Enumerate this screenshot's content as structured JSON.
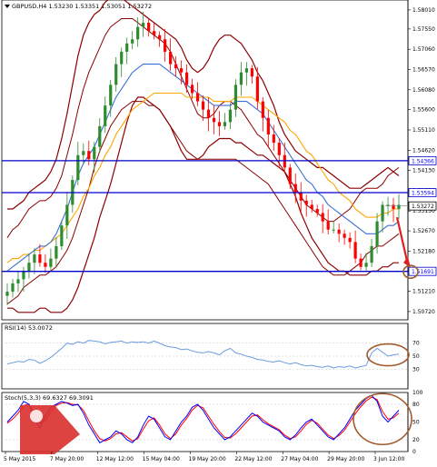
{
  "colors": {
    "bull_candle": "#2e8b2e",
    "bear_candle": "#ff0000",
    "envelope": "#8b0000",
    "ma_fast": "#3c6fd6",
    "ma_slow": "#ffa500",
    "levels": "#0000cd",
    "rsi_line": "#6a9be0",
    "stoch_main": "#0000ff",
    "stoch_signal": "#ff0000",
    "annotation": "#a05a2c",
    "arrow": "#e02020"
  },
  "icons": [
    "dropdown-triangle-icon",
    "instaforex-logo-icon",
    "down-arrow-annotation",
    "ellipse-annotation"
  ],
  "chart_data": [
    {
      "type": "line",
      "header": "GBPUSD,H4  1.53230 1.53351 1.53051 1.53272",
      "y_ticks": [
        "1.58010",
        "1.57550",
        "1.57060",
        "1.56570",
        "1.56080",
        "1.55600",
        "1.55110",
        "1.54620",
        "1.54130",
        "1.53650",
        "1.53150",
        "1.52670",
        "1.52180",
        "1.51690",
        "1.51210",
        "1.50720"
      ],
      "ylim": [
        1.5052,
        1.5825
      ],
      "x_ticks": [
        "5 May 2015",
        "7 May 20:00",
        "12 May 12:00",
        "15 May 04:00",
        "19 May 20:00",
        "22 May 12:00",
        "27 May 04:00",
        "29 May 20:00",
        "3 Jun 12:00"
      ],
      "levels": [
        {
          "label": "1.54366",
          "value": 1.54366
        },
        {
          "label": "1.53594",
          "value": 1.53594
        },
        {
          "label": "1.51691",
          "value": 1.51691
        }
      ],
      "current_price_label": "1.53272",
      "current_price": 1.53272,
      "series": [
        {
          "values": [
            1.512,
            1.514,
            1.515,
            1.517,
            1.519,
            1.521,
            1.519,
            1.518,
            1.52,
            1.523,
            1.528,
            1.533,
            1.539,
            1.545,
            1.546,
            1.544,
            1.547,
            1.552,
            1.557,
            1.562,
            1.567,
            1.57,
            1.572,
            1.573,
            1.576,
            1.577,
            1.575,
            1.574,
            1.573,
            1.57,
            1.567,
            1.566,
            1.565,
            1.562,
            1.56,
            1.558,
            1.556,
            1.554,
            1.553,
            1.552,
            1.553,
            1.556,
            1.562,
            1.565,
            1.566,
            1.564,
            1.558,
            1.554,
            1.55,
            1.548,
            1.545,
            1.542,
            1.538,
            1.536,
            1.534,
            1.533,
            1.532,
            1.531,
            1.529,
            1.527,
            1.527,
            1.526,
            1.525,
            1.524,
            1.52,
            1.518,
            1.519,
            1.523,
            1.529,
            1.533,
            1.533,
            1.532,
            1.533
          ]
        },
        {
          "values": [
            1.517,
            1.518,
            1.519,
            1.52,
            1.521,
            1.522,
            1.523,
            1.523,
            1.524,
            1.526,
            1.529,
            1.532,
            1.536,
            1.54,
            1.543,
            1.545,
            1.547,
            1.55,
            1.553,
            1.556,
            1.559,
            1.561,
            1.563,
            1.565,
            1.566,
            1.567,
            1.567,
            1.567,
            1.567,
            1.566,
            1.565,
            1.564,
            1.563,
            1.562,
            1.561,
            1.56,
            1.559,
            1.558,
            1.557,
            1.557,
            1.557,
            1.557,
            1.558,
            1.558,
            1.558,
            1.557,
            1.556,
            1.555,
            1.553,
            1.551,
            1.549,
            1.547,
            1.545,
            1.543,
            1.541,
            1.539,
            1.538,
            1.536,
            1.535,
            1.533,
            1.532,
            1.531,
            1.53,
            1.529,
            1.528,
            1.527,
            1.526,
            1.526,
            1.526,
            1.527,
            1.528,
            1.528,
            1.529
          ]
        },
        {
          "values": [
            1.519,
            1.52,
            1.52,
            1.521,
            1.521,
            1.522,
            1.522,
            1.523,
            1.524,
            1.525,
            1.526,
            1.528,
            1.53,
            1.532,
            1.535,
            1.537,
            1.54,
            1.542,
            1.545,
            1.547,
            1.55,
            1.552,
            1.554,
            1.556,
            1.557,
            1.558,
            1.559,
            1.56,
            1.56,
            1.56,
            1.56,
            1.56,
            1.56,
            1.559,
            1.559,
            1.559,
            1.559,
            1.559,
            1.558,
            1.558,
            1.558,
            1.558,
            1.559,
            1.559,
            1.559,
            1.559,
            1.558,
            1.557,
            1.556,
            1.555,
            1.554,
            1.553,
            1.551,
            1.55,
            1.548,
            1.546,
            1.545,
            1.543,
            1.541,
            1.539,
            1.538,
            1.536,
            1.535,
            1.534,
            1.532,
            1.531,
            1.53,
            1.53,
            1.53,
            1.531,
            1.531,
            1.532,
            1.532
          ]
        },
        {
          "values": [
            1.532,
            1.532,
            1.533,
            1.534,
            1.536,
            1.537,
            1.538,
            1.539,
            1.541,
            1.544,
            1.549,
            1.555,
            1.562,
            1.569,
            1.574,
            1.577,
            1.579,
            1.58,
            1.582,
            1.583,
            1.583,
            1.583,
            1.582,
            1.581,
            1.58,
            1.579,
            1.578,
            1.577,
            1.576,
            1.575,
            1.574,
            1.573,
            1.571,
            1.568,
            1.566,
            1.565,
            1.566,
            1.568,
            1.571,
            1.573,
            1.574,
            1.574,
            1.573,
            1.572,
            1.57,
            1.568,
            1.565,
            1.563,
            1.56,
            1.557,
            1.553,
            1.55,
            1.548,
            1.546,
            1.545,
            1.544,
            1.543,
            1.542,
            1.542,
            1.541,
            1.54,
            1.539,
            1.538,
            1.537,
            1.537,
            1.537,
            1.538,
            1.539,
            1.54,
            1.541,
            1.542,
            1.541,
            1.54
          ]
        },
        {
          "values": [
            1.508,
            1.508,
            1.507,
            1.507,
            1.507,
            1.507,
            1.508,
            1.508,
            1.507,
            1.507,
            1.507,
            1.508,
            1.51,
            1.513,
            1.517,
            1.521,
            1.525,
            1.53,
            1.534,
            1.538,
            1.543,
            1.548,
            1.553,
            1.557,
            1.559,
            1.559,
            1.558,
            1.557,
            1.556,
            1.554,
            1.552,
            1.549,
            1.546,
            1.544,
            1.544,
            1.544,
            1.545,
            1.547,
            1.548,
            1.549,
            1.549,
            1.549,
            1.548,
            1.548,
            1.547,
            1.546,
            1.545,
            1.545,
            1.544,
            1.543,
            1.542,
            1.541,
            1.538,
            1.535,
            1.531,
            1.528,
            1.525,
            1.523,
            1.521,
            1.519,
            1.518,
            1.517,
            1.517,
            1.516,
            1.516,
            1.516,
            1.516,
            1.517,
            1.517,
            1.518,
            1.518,
            1.519,
            1.519
          ]
        },
        {
          "values": [
            1.525,
            1.527,
            1.528,
            1.53,
            1.532,
            1.533,
            1.534,
            1.534,
            1.535,
            1.537,
            1.54,
            1.545,
            1.55,
            1.556,
            1.561,
            1.565,
            1.568,
            1.571,
            1.574,
            1.576,
            1.577,
            1.578,
            1.578,
            1.578,
            1.577,
            1.576,
            1.575,
            1.574,
            1.573,
            1.572,
            1.57,
            1.567,
            1.564,
            1.561,
            1.558,
            1.555,
            1.554,
            1.554,
            1.555,
            1.557,
            1.558,
            1.558,
            1.557,
            1.556,
            1.554,
            1.552,
            1.55,
            1.549,
            1.547,
            1.545,
            1.543,
            1.541,
            1.539,
            1.537,
            1.535,
            1.533,
            1.532,
            1.531,
            1.53,
            1.529,
            1.529,
            1.53,
            1.531,
            1.532,
            1.534,
            1.536,
            1.537,
            1.537,
            1.537,
            1.538,
            1.54,
            1.541,
            1.542
          ]
        },
        {
          "values": [
            1.509,
            1.51,
            1.511,
            1.513,
            1.514,
            1.515,
            1.516,
            1.516,
            1.517,
            1.518,
            1.52,
            1.522,
            1.525,
            1.529,
            1.533,
            1.537,
            1.542,
            1.546,
            1.549,
            1.552,
            1.554,
            1.556,
            1.557,
            1.558,
            1.558,
            1.558,
            1.557,
            1.557,
            1.556,
            1.554,
            1.552,
            1.55,
            1.548,
            1.546,
            1.545,
            1.544,
            1.544,
            1.544,
            1.544,
            1.544,
            1.544,
            1.544,
            1.544,
            1.543,
            1.542,
            1.541,
            1.54,
            1.539,
            1.538,
            1.536,
            1.534,
            1.532,
            1.53,
            1.528,
            1.526,
            1.524,
            1.522,
            1.52,
            1.518,
            1.517,
            1.516,
            1.516,
            1.516,
            1.517,
            1.518,
            1.519,
            1.521,
            1.522,
            1.523,
            1.523,
            1.524,
            1.525,
            1.526
          ]
        }
      ]
    },
    {
      "type": "line",
      "header": "RSI(14) 53.0072",
      "y_ticks": [
        "70",
        "50",
        "30"
      ],
      "ylim": [
        0,
        100
      ],
      "series": [
        {
          "values": [
            38,
            40,
            42,
            41,
            45,
            44,
            39,
            43,
            48,
            55,
            62,
            70,
            68,
            72,
            70,
            74,
            73,
            72,
            69,
            71,
            72,
            73,
            70,
            72,
            71,
            72,
            70,
            73,
            70,
            66,
            64,
            63,
            60,
            61,
            58,
            56,
            55,
            57,
            55,
            52,
            58,
            62,
            55,
            53,
            50,
            48,
            45,
            44,
            42,
            41,
            43,
            40,
            38,
            40,
            37,
            35,
            36,
            34,
            33,
            35,
            32,
            34,
            33,
            35,
            32,
            34,
            36,
            55,
            62,
            56,
            50,
            52,
            53
          ]
        }
      ]
    },
    {
      "type": "line",
      "header": "Stoch(5,3,3) 69.6327 69.3091",
      "y_ticks": [
        "100",
        "80",
        "50",
        "20",
        "0"
      ],
      "ylim": [
        0,
        100
      ],
      "series": [
        {
          "values": [
            50,
            60,
            70,
            85,
            80,
            55,
            40,
            60,
            75,
            80,
            85,
            82,
            78,
            80,
            65,
            45,
            30,
            15,
            20,
            25,
            35,
            30,
            20,
            15,
            25,
            45,
            60,
            55,
            40,
            25,
            20,
            35,
            50,
            60,
            75,
            80,
            70,
            55,
            40,
            30,
            20,
            25,
            35,
            45,
            55,
            65,
            60,
            50,
            45,
            40,
            35,
            25,
            20,
            28,
            40,
            50,
            55,
            45,
            35,
            25,
            20,
            30,
            40,
            55,
            70,
            80,
            90,
            95,
            85,
            60,
            50,
            60,
            70
          ]
        },
        {
          "values": [
            48,
            55,
            65,
            78,
            80,
            65,
            48,
            52,
            68,
            78,
            82,
            83,
            80,
            79,
            70,
            52,
            35,
            22,
            18,
            22,
            30,
            32,
            25,
            18,
            22,
            38,
            52,
            57,
            45,
            30,
            22,
            30,
            45,
            56,
            70,
            78,
            74,
            60,
            46,
            34,
            24,
            23,
            30,
            40,
            50,
            60,
            62,
            54,
            47,
            42,
            37,
            28,
            22,
            25,
            35,
            46,
            53,
            48,
            38,
            28,
            22,
            27,
            36,
            50,
            64,
            76,
            86,
            92,
            88,
            68,
            55,
            57,
            65
          ]
        }
      ]
    }
  ]
}
